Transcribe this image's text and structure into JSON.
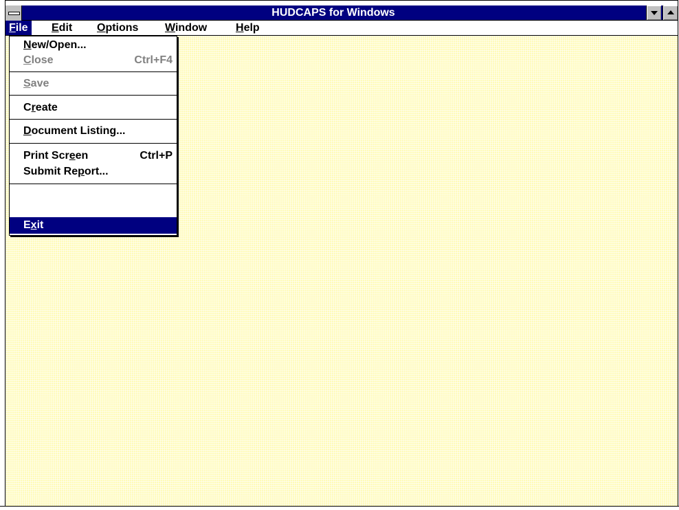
{
  "window": {
    "title": "HUDCAPS for Windows"
  },
  "menubar": {
    "items": [
      {
        "label": "File",
        "mnemonic": "F",
        "rest": "ile"
      },
      {
        "label": "Edit",
        "mnemonic": "E",
        "rest": "dit"
      },
      {
        "label": "Options",
        "mnemonic": "O",
        "rest": "ptions"
      },
      {
        "label": "Window",
        "mnemonic": "W",
        "rest": "indow"
      },
      {
        "label": "Help",
        "mnemonic": "H",
        "rest": "elp"
      }
    ]
  },
  "file_menu": {
    "new_open": {
      "pre": "",
      "mn": "N",
      "post": "ew/Open..."
    },
    "close": {
      "pre": "",
      "mn": "C",
      "post": "lose",
      "shortcut": "Ctrl+F4"
    },
    "save": {
      "pre": "",
      "mn": "S",
      "post": "ave"
    },
    "create": {
      "pre": "C",
      "mn": "r",
      "post": "eate"
    },
    "document_listing": {
      "pre": "",
      "mn": "D",
      "post": "ocument Listing..."
    },
    "print_screen": {
      "pre": "Print Scr",
      "mn": "e",
      "post": "en",
      "shortcut": "Ctrl+P"
    },
    "submit_report": {
      "pre": "Submit Re",
      "mn": "p",
      "post": "ort..."
    },
    "exit": {
      "pre": "E",
      "mn": "x",
      "post": "it"
    }
  },
  "colors": {
    "titlebar": "#000080",
    "client": "#fffbb8",
    "highlight": "#000080"
  },
  "icons": [
    "system-menu-icon",
    "minimize-arrow-icon",
    "maximize-arrow-icon"
  ]
}
